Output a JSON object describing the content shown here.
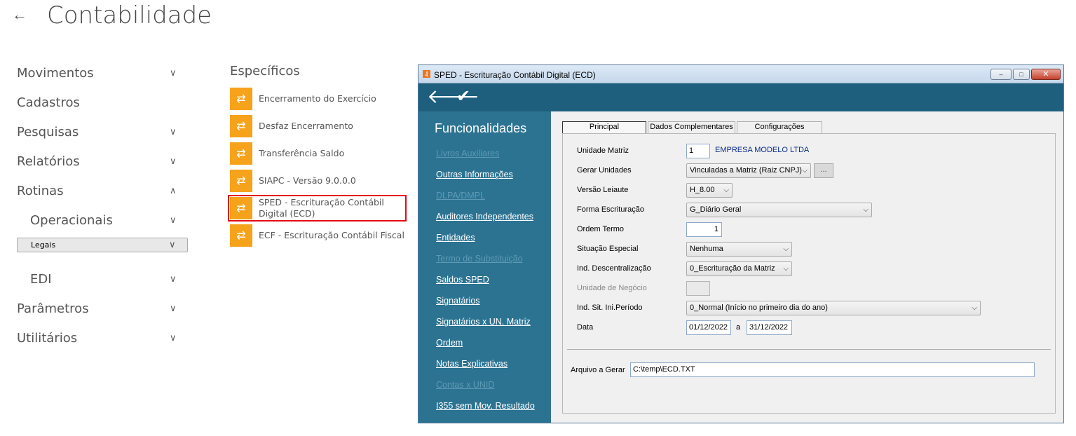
{
  "page": {
    "title": "Contabilidade",
    "back_icon": "←"
  },
  "nav": {
    "items": [
      {
        "label": "Movimentos",
        "chevron": "∨"
      },
      {
        "label": "Cadastros",
        "chevron": ""
      },
      {
        "label": "Pesquisas",
        "chevron": "∨"
      },
      {
        "label": "Relatórios",
        "chevron": "∨"
      },
      {
        "label": "Rotinas",
        "chevron": "∧"
      },
      {
        "label": "Operacionais",
        "chevron": "∨"
      },
      {
        "label": "Legais",
        "chevron": "∨"
      },
      {
        "label": "EDI",
        "chevron": "∨"
      },
      {
        "label": "Parâmetros",
        "chevron": "∨"
      },
      {
        "label": "Utilitários",
        "chevron": "∨"
      }
    ]
  },
  "especificos": {
    "title": "Específicos",
    "icon_glyph": "⇄",
    "items": [
      {
        "label": "Encerramento do Exercício"
      },
      {
        "label": "Desfaz Encerramento"
      },
      {
        "label": "Transferência Saldo"
      },
      {
        "label": "SIAPC - Versão 9.0.0.0"
      },
      {
        "label": "SPED - Escrituração Contábil Digital (ECD)"
      },
      {
        "label": "ECF - Escrituração Contábil Fiscal"
      }
    ],
    "highlight_color": "#e30613",
    "icon_color": "#f7a21b"
  },
  "window": {
    "title": "SPED - Escrituração Contábil Digital (ECD)",
    "app_icon": "₰",
    "controls": {
      "minimize": "–",
      "maximize": "□",
      "close": "✕"
    },
    "toolbar": {
      "back_icon": "🡐",
      "ok_icon": "✔"
    },
    "accent_color": "#1e5f7e",
    "funcionalidades": {
      "title": "Funcionalidades",
      "links": [
        {
          "label": "Livros Auxiliares",
          "enabled": false
        },
        {
          "label": "Outras Informações",
          "enabled": true
        },
        {
          "label": "DLPA/DMPL",
          "enabled": false
        },
        {
          "label": "Auditores Independentes",
          "enabled": true
        },
        {
          "label": "Entidades",
          "enabled": true
        },
        {
          "label": "Termo de Substituição",
          "enabled": false
        },
        {
          "label": "Saldos SPED",
          "enabled": true
        },
        {
          "label": "Signatários",
          "enabled": true
        },
        {
          "label": "Signatários x UN. Matriz",
          "enabled": true
        },
        {
          "label": "Ordem",
          "enabled": true
        },
        {
          "label": "Notas Explicativas",
          "enabled": true
        },
        {
          "label": "Contas x UNID",
          "enabled": false
        },
        {
          "label": "I355 sem Mov. Resultado",
          "enabled": true
        }
      ]
    },
    "tabs": [
      {
        "label": "Principal",
        "active": true
      },
      {
        "label": "Dados Complementares",
        "active": false
      },
      {
        "label": "Configurações",
        "active": false
      }
    ],
    "form": {
      "unidade_matriz": {
        "label": "Unidade Matriz",
        "value": "1",
        "empresa": "EMPRESA MODELO LTDA"
      },
      "gerar_unidades": {
        "label": "Gerar Unidades",
        "value": "Vinculadas a Matriz (Raiz CNPJ)",
        "button": "..."
      },
      "versao_leiaute": {
        "label": "Versão Leiaute",
        "value": "H_8.00"
      },
      "forma_escrituracao": {
        "label": "Forma Escrituração",
        "value": "G_Diário Geral"
      },
      "ordem_termo": {
        "label": "Ordem Termo",
        "value": "1"
      },
      "situacao_especial": {
        "label": "Situação Especial",
        "value": "Nenhuma"
      },
      "ind_descentralizacao": {
        "label": "Ind. Descentralização",
        "value": "0_Escrituração da Matriz"
      },
      "unidade_negocio": {
        "label": "Unidade de Negócio",
        "value": ""
      },
      "ind_sit_ini_periodo": {
        "label": "Ind. Sit. Ini.Período",
        "value": "0_Normal (Início no primeiro dia do ano)"
      },
      "data": {
        "label": "Data",
        "from": "01/12/2022",
        "separator": "a",
        "to": "31/12/2022"
      },
      "arquivo": {
        "label": "Arquivo a Gerar",
        "value": "C:\\temp\\ECD.TXT"
      }
    }
  }
}
